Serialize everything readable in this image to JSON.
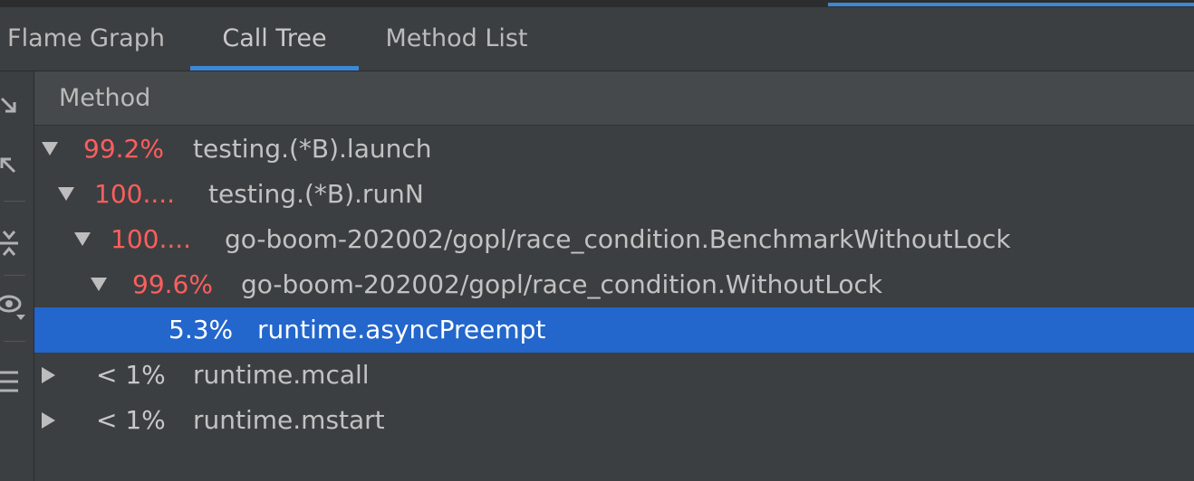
{
  "tabs": [
    {
      "label": "Flame Graph"
    },
    {
      "label": "Call Tree"
    },
    {
      "label": "Method List"
    }
  ],
  "active_tab": "Call Tree",
  "table": {
    "column_header": "Method",
    "rows": [
      {
        "expanded": true,
        "percent": "99.2%",
        "method": "testing.(*B).launch",
        "percent_color": "#ff5e5e"
      },
      {
        "expanded": true,
        "percent": "100....",
        "method": "testing.(*B).runN",
        "percent_color": "#ff5e5e"
      },
      {
        "expanded": true,
        "percent": "100....",
        "method": "go-boom-202002/gopl/race_condition.BenchmarkWithoutLock",
        "percent_color": "#ff5e5e"
      },
      {
        "expanded": true,
        "percent": "99.6%",
        "method": "go-boom-202002/gopl/race_condition.WithoutLock",
        "percent_color": "#ff5e5e"
      },
      {
        "expanded": null,
        "percent": "5.3%",
        "method": "runtime.asyncPreempt",
        "selected": true
      },
      {
        "expanded": false,
        "percent": "< 1%",
        "method": "runtime.mcall"
      },
      {
        "expanded": false,
        "percent": "< 1%",
        "method": "runtime.mstart"
      }
    ]
  },
  "toolbar_icons": [
    "expand-all-icon",
    "collapse-all-icon",
    "merge-icon",
    "view-options-icon",
    "menu-icon"
  ],
  "colors": {
    "accent": "#3d87d6",
    "selection": "#2366cc",
    "hot_percent": "#ff5e5e",
    "background": "#3c3f41"
  }
}
